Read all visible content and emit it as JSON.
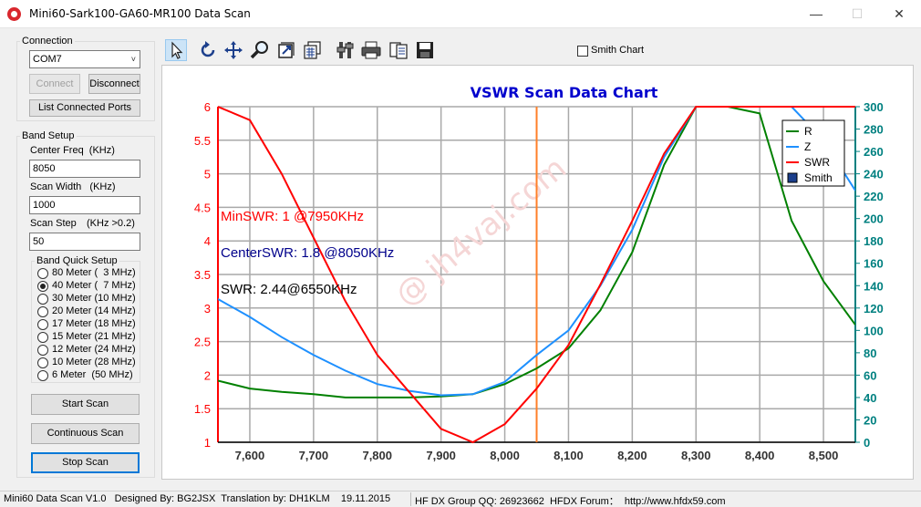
{
  "window": {
    "title": "Mini60-Sark100-GA60-MR100 Data Scan",
    "minimize": "—",
    "maximize": "☐",
    "close": "✕"
  },
  "connection": {
    "title": "Connection",
    "port": "COM7",
    "connect": "Connect",
    "disconnect": "Disconnect",
    "list_ports": "List Connected Ports"
  },
  "band_setup": {
    "title": "Band Setup",
    "center_label": "Center Freq  (KHz)",
    "center_value": "8050",
    "width_label": "Scan Width   (KHz)",
    "width_value": "1000",
    "step_label": "Scan Step",
    "step_hint": "(KHz >0.2)",
    "step_value": "50",
    "quick_title": "Band Quick Setup",
    "bands": [
      {
        "label": "80 Meter (  3 MHz)",
        "checked": false
      },
      {
        "label": "40 Meter (  7 MHz)",
        "checked": true
      },
      {
        "label": "30 Meter (10 MHz)",
        "checked": false
      },
      {
        "label": "20 Meter (14 MHz)",
        "checked": false
      },
      {
        "label": "17 Meter (18 MHz)",
        "checked": false
      },
      {
        "label": "15 Meter (21 MHz)",
        "checked": false
      },
      {
        "label": "12 Meter (24 MHz)",
        "checked": false
      },
      {
        "label": "10 Meter (28 MHz)",
        "checked": false
      },
      {
        "label": "6 Meter  (50 MHz)",
        "checked": false
      }
    ],
    "start_scan": "Start Scan",
    "continuous_scan": "Continuous Scan",
    "stop_scan": "Stop Scan"
  },
  "toolbar": {
    "tools": [
      "pointer-icon",
      "rotate-icon",
      "move-icon",
      "zoom-icon",
      "export-icon",
      "data-icon",
      "settings-icon",
      "print-icon",
      "copy-icon",
      "save-icon"
    ],
    "smith_chart_label": "Smith Chart",
    "smith_chart_checked": false
  },
  "chart_data": {
    "type": "line",
    "title": "VSWR Scan Data Chart",
    "watermark": "@ jh4vaj.com",
    "x_ticks": [
      "7,600",
      "7,700",
      "7,800",
      "7,900",
      "8,000",
      "8,100",
      "8,200",
      "8,300",
      "8,400",
      "8,500"
    ],
    "xlim": [
      7550,
      8550
    ],
    "y_left_ticks": [
      "1",
      "1.5",
      "2",
      "2.5",
      "3",
      "3.5",
      "4",
      "4.5",
      "5",
      "5.5",
      "6"
    ],
    "ylim_left": [
      1,
      6
    ],
    "y_right_ticks": [
      "0",
      "20",
      "40",
      "60",
      "80",
      "100",
      "120",
      "140",
      "160",
      "180",
      "200",
      "220",
      "240",
      "260",
      "280",
      "300"
    ],
    "ylim_right": [
      0,
      300
    ],
    "marker_x": 8050,
    "x": [
      7550,
      7600,
      7650,
      7700,
      7750,
      7800,
      7850,
      7900,
      7950,
      8000,
      8050,
      8100,
      8150,
      8200,
      8250,
      8300,
      8350,
      8400,
      8450,
      8500,
      8550
    ],
    "series": [
      {
        "name": "R",
        "color": "#008000",
        "axis": "right",
        "values": [
          55,
          48,
          45,
          43,
          40,
          40,
          40,
          41,
          43,
          52,
          66,
          84,
          118,
          170,
          248,
          300,
          300,
          294,
          198,
          144,
          105
        ]
      },
      {
        "name": "Z",
        "color": "#1e90ff",
        "axis": "right",
        "values": [
          128,
          112,
          94,
          78,
          64,
          52,
          46,
          42,
          43,
          54,
          78,
          100,
          140,
          190,
          255,
          300,
          300,
          300,
          300,
          270,
          225
        ]
      },
      {
        "name": "SWR",
        "color": "#ff0000",
        "axis": "left",
        "values": [
          6,
          5.8,
          5.0,
          4.05,
          3.1,
          2.3,
          1.75,
          1.2,
          1.0,
          1.27,
          1.8,
          2.45,
          3.35,
          4.3,
          5.3,
          6,
          6,
          6,
          6,
          6,
          6
        ]
      }
    ],
    "legend": {
      "position": "top-right",
      "items": [
        {
          "label": "R",
          "color": "#008000"
        },
        {
          "label": "Z",
          "color": "#1e90ff"
        },
        {
          "label": "SWR",
          "color": "#ff0000"
        },
        {
          "label": "Smith",
          "color": "#1c3f8c",
          "box": true
        }
      ]
    },
    "annotations": [
      {
        "text": "MinSWR: 1  @7950KHz",
        "color": "#ff0000"
      },
      {
        "text": "CenterSWR: 1.8  @8050KHz",
        "color": "#00008b"
      },
      {
        "text": "SWR: 2.44@6550KHz",
        "color": "#000000"
      }
    ]
  },
  "status": {
    "left": "Mini60 Data Scan V1.0   Designed By: BG2JSX  Translation by: DH1KLM    19.11.2015",
    "right": "HF DX Group QQ: 26923662  HFDX Forum：  http://www.hfdx59.com"
  }
}
